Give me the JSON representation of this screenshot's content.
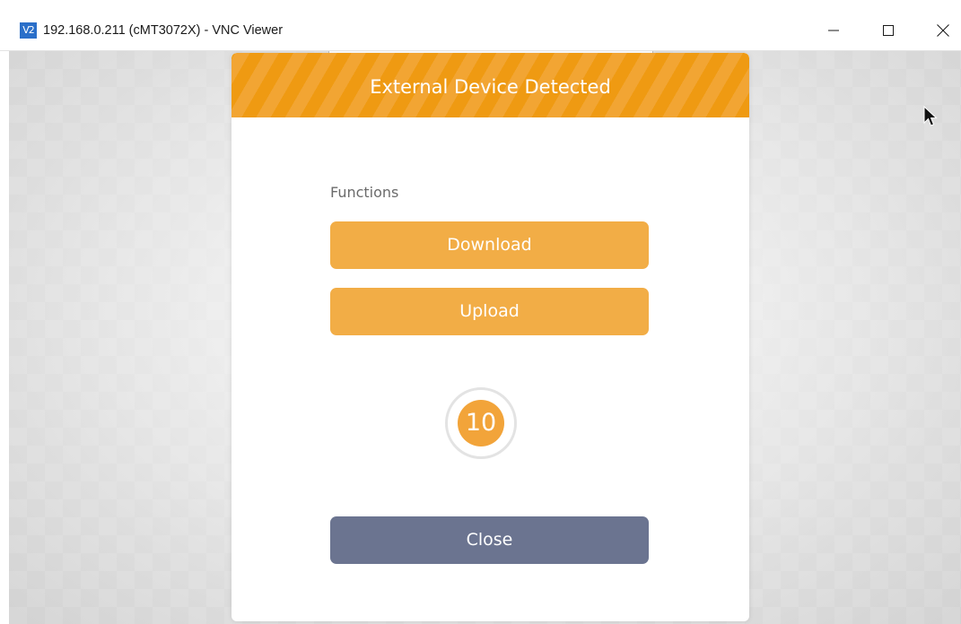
{
  "window": {
    "app_icon_text": "V2",
    "title": "192.168.0.211 (cMT3072X) - VNC Viewer",
    "controls": [
      "minimize-icon",
      "maximize-icon",
      "close-icon"
    ]
  },
  "dialog": {
    "title": "External Device Detected",
    "section_label": "Functions",
    "download_label": "Download",
    "upload_label": "Upload",
    "countdown": "10",
    "close_label": "Close"
  },
  "colors": {
    "header_orange": "#ef9a12",
    "button_orange": "#f2ad46",
    "close_button": "#6b7490",
    "app_icon_blue": "#2a6fc9"
  }
}
